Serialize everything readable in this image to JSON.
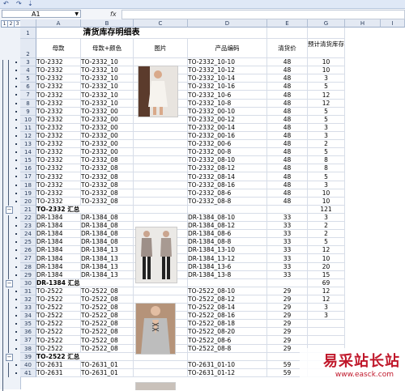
{
  "quick_access": {
    "undo": "↶",
    "redo": "↷",
    "custom": "⇣"
  },
  "formula_bar": {
    "name_box": "A1",
    "fx": "fx",
    "content": ""
  },
  "outline_levels": [
    "1",
    "2",
    "3"
  ],
  "columns": [
    "A",
    "B",
    "C",
    "D",
    "E",
    "G",
    "H",
    "I"
  ],
  "title": "清货库存明细表",
  "headers": {
    "a": "母款",
    "b": "母款+颜色",
    "c": "图片",
    "d": "产品编码",
    "e": "清货价",
    "g": "预计清货库存"
  },
  "rows": [
    {
      "n": "3",
      "a": "TO-2332",
      "b": "TO-2332_10",
      "d": "TO-2332_10-10",
      "e": "48",
      "g": "10"
    },
    {
      "n": "4",
      "a": "TO-2332",
      "b": "TO-2332_10",
      "d": "TO-2332_10-12",
      "e": "48",
      "g": "10"
    },
    {
      "n": "5",
      "a": "TO-2332",
      "b": "TO-2332_10",
      "d": "TO-2332_10-14",
      "e": "48",
      "g": "3"
    },
    {
      "n": "6",
      "a": "TO-2332",
      "b": "TO-2332_10",
      "d": "TO-2332_10-16",
      "e": "48",
      "g": "5"
    },
    {
      "n": "7",
      "a": "TO-2332",
      "b": "TO-2332_10",
      "d": "TO-2332_10-6",
      "e": "48",
      "g": "12"
    },
    {
      "n": "8",
      "a": "TO-2332",
      "b": "TO-2332_10",
      "d": "TO-2332_10-8",
      "e": "48",
      "g": "12"
    },
    {
      "n": "9",
      "a": "TO-2332",
      "b": "TO-2332_00",
      "d": "TO-2332_00-10",
      "e": "48",
      "g": "5"
    },
    {
      "n": "10",
      "a": "TO-2332",
      "b": "TO-2332_00",
      "d": "TO-2332_00-12",
      "e": "48",
      "g": "5"
    },
    {
      "n": "11",
      "a": "TO-2332",
      "b": "TO-2332_00",
      "d": "TO-2332_00-14",
      "e": "48",
      "g": "3"
    },
    {
      "n": "12",
      "a": "TO-2332",
      "b": "TO-2332_00",
      "d": "TO-2332_00-16",
      "e": "48",
      "g": "3"
    },
    {
      "n": "13",
      "a": "TO-2332",
      "b": "TO-2332_00",
      "d": "TO-2332_00-6",
      "e": "48",
      "g": "2"
    },
    {
      "n": "14",
      "a": "TO-2332",
      "b": "TO-2332_00",
      "d": "TO-2332_00-8",
      "e": "48",
      "g": "5"
    },
    {
      "n": "15",
      "a": "TO-2332",
      "b": "TO-2332_08",
      "d": "TO-2332_08-10",
      "e": "48",
      "g": "8"
    },
    {
      "n": "16",
      "a": "TO-2332",
      "b": "TO-2332_08",
      "d": "TO-2332_08-12",
      "e": "48",
      "g": "8"
    },
    {
      "n": "17",
      "a": "TO-2332",
      "b": "TO-2332_08",
      "d": "TO-2332_08-14",
      "e": "48",
      "g": "5"
    },
    {
      "n": "18",
      "a": "TO-2332",
      "b": "TO-2332_08",
      "d": "TO-2332_08-16",
      "e": "48",
      "g": "3"
    },
    {
      "n": "19",
      "a": "TO-2332",
      "b": "TO-2332_08",
      "d": "TO-2332_08-6",
      "e": "48",
      "g": "10"
    },
    {
      "n": "20",
      "a": "TO-2332",
      "b": "TO-2332_08",
      "d": "TO-2332_08-8",
      "e": "48",
      "g": "10"
    },
    {
      "n": "21",
      "a": "TO-2332 汇总",
      "b": "",
      "d": "",
      "e": "",
      "g": "121",
      "sub": true
    },
    {
      "n": "22",
      "a": "DR-1384",
      "b": "DR-1384_08",
      "d": "DR-1384_08-10",
      "e": "33",
      "g": "3"
    },
    {
      "n": "23",
      "a": "DR-1384",
      "b": "DR-1384_08",
      "d": "DR-1384_08-12",
      "e": "33",
      "g": "2"
    },
    {
      "n": "24",
      "a": "DR-1384",
      "b": "DR-1384_08",
      "d": "DR-1384_08-6",
      "e": "33",
      "g": "2"
    },
    {
      "n": "25",
      "a": "DR-1384",
      "b": "DR-1384_08",
      "d": "DR-1384_08-8",
      "e": "33",
      "g": "5"
    },
    {
      "n": "26",
      "a": "DR-1384",
      "b": "DR-1384_13",
      "d": "DR-1384_13-10",
      "e": "33",
      "g": "12"
    },
    {
      "n": "27",
      "a": "DR-1384",
      "b": "DR-1384_13",
      "d": "DR-1384_13-12",
      "e": "33",
      "g": "10"
    },
    {
      "n": "28",
      "a": "DR-1384",
      "b": "DR-1384_13",
      "d": "DR-1384_13-6",
      "e": "33",
      "g": "20"
    },
    {
      "n": "29",
      "a": "DR-1384",
      "b": "DR-1384_13",
      "d": "DR-1384_13-8",
      "e": "33",
      "g": "15"
    },
    {
      "n": "30",
      "a": "DR-1384 汇总",
      "b": "",
      "d": "",
      "e": "",
      "g": "69",
      "sub": true
    },
    {
      "n": "31",
      "a": "TO-2522",
      "b": "TO-2522_08",
      "d": "TO-2522_08-10",
      "e": "29",
      "g": "12"
    },
    {
      "n": "32",
      "a": "TO-2522",
      "b": "TO-2522_08",
      "d": "TO-2522_08-12",
      "e": "29",
      "g": "12"
    },
    {
      "n": "33",
      "a": "TO-2522",
      "b": "TO-2522_08",
      "d": "TO-2522_08-14",
      "e": "29",
      "g": "3"
    },
    {
      "n": "34",
      "a": "TO-2522",
      "b": "TO-2522_08",
      "d": "TO-2522_08-16",
      "e": "29",
      "g": "3"
    },
    {
      "n": "35",
      "a": "TO-2522",
      "b": "TO-2522_08",
      "d": "TO-2522_08-18",
      "e": "29",
      "g": ""
    },
    {
      "n": "36",
      "a": "TO-2522",
      "b": "TO-2522_08",
      "d": "TO-2522_08-20",
      "e": "29",
      "g": ""
    },
    {
      "n": "37",
      "a": "TO-2522",
      "b": "TO-2522_08",
      "d": "TO-2522_08-6",
      "e": "29",
      "g": ""
    },
    {
      "n": "38",
      "a": "TO-2522",
      "b": "TO-2522_08",
      "d": "TO-2522_08-8",
      "e": "29",
      "g": ""
    },
    {
      "n": "39",
      "a": "TO-2522 汇总",
      "b": "",
      "d": "",
      "e": "",
      "g": "",
      "sub": true
    },
    {
      "n": "40",
      "a": "TO-2631",
      "b": "TO-2631_01",
      "d": "TO-2631_01-10",
      "e": "59",
      "g": ""
    },
    {
      "n": "41",
      "a": "TO-2631",
      "b": "TO-2631_01",
      "d": "TO-2631_01-12",
      "e": "59",
      "g": ""
    }
  ],
  "watermark": {
    "line1": "易采站长站",
    "line2": "www.easck.com"
  },
  "colors": {
    "grid": "#d7dde8",
    "header_bg": "#e3e9f3",
    "watermark": "#c0182b"
  }
}
